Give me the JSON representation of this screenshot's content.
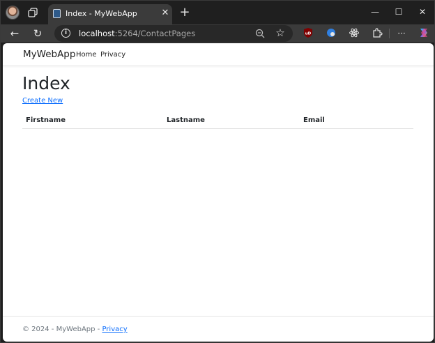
{
  "browser": {
    "tab_title": "Index - MyWebApp",
    "url_host": "localhost",
    "url_rest": ":5264/ContactPages",
    "new_tab_glyph": "+",
    "close_glyph": "✕",
    "window_buttons": {
      "minimize": "—",
      "maximize": "☐",
      "close": "✕"
    },
    "back_glyph": "←",
    "refresh_glyph": "↻",
    "favorite_glyph": "☆",
    "menu_glyph": "···",
    "extensions": {
      "ublock": "UB"
    }
  },
  "navbar": {
    "brand": "MyWebApp",
    "links": [
      "Home",
      "Privacy"
    ]
  },
  "main": {
    "title": "Index",
    "create_link": "Create New",
    "table": {
      "headers": [
        "Firstname",
        "Lastname",
        "Email"
      ],
      "rows": []
    }
  },
  "footer": {
    "text": "© 2024 - MyWebApp - ",
    "link": "Privacy"
  },
  "colors": {
    "link": "#0d6efd",
    "chrome_dark": "#1f1f1f",
    "chrome_toolbar": "#3b3b3b"
  }
}
